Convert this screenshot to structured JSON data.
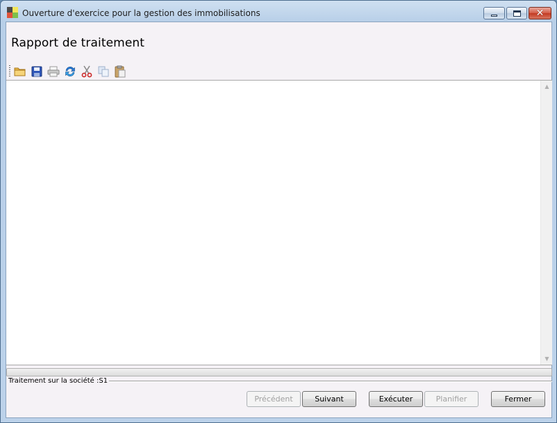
{
  "window": {
    "title": "Ouverture d'exercice pour la gestion des immobilisations",
    "controls": {
      "minimize": "minimize-icon",
      "maximize": "maximize-icon",
      "close": "close-icon"
    }
  },
  "page": {
    "title": "Rapport de traitement"
  },
  "toolbar": {
    "buttons": [
      {
        "name": "open",
        "icon": "folder-icon"
      },
      {
        "name": "save",
        "icon": "floppy-disk-icon"
      },
      {
        "name": "print",
        "icon": "printer-icon"
      },
      {
        "name": "refresh",
        "icon": "refresh-icon"
      },
      {
        "name": "cut",
        "icon": "scissors-icon"
      },
      {
        "name": "copy",
        "icon": "copy-icon"
      },
      {
        "name": "paste",
        "icon": "paste-icon"
      }
    ]
  },
  "report": {
    "content": ""
  },
  "status": {
    "text": "Traitement sur la société :S1"
  },
  "buttons": {
    "previous": "Précédent",
    "next": "Suivant",
    "execute": "Exécuter",
    "schedule": "Planifier",
    "close": "Fermer"
  },
  "colors": {
    "client_background": "#f5f2f6",
    "frame": "#bcd2ea",
    "close_button": "#c23a22"
  }
}
